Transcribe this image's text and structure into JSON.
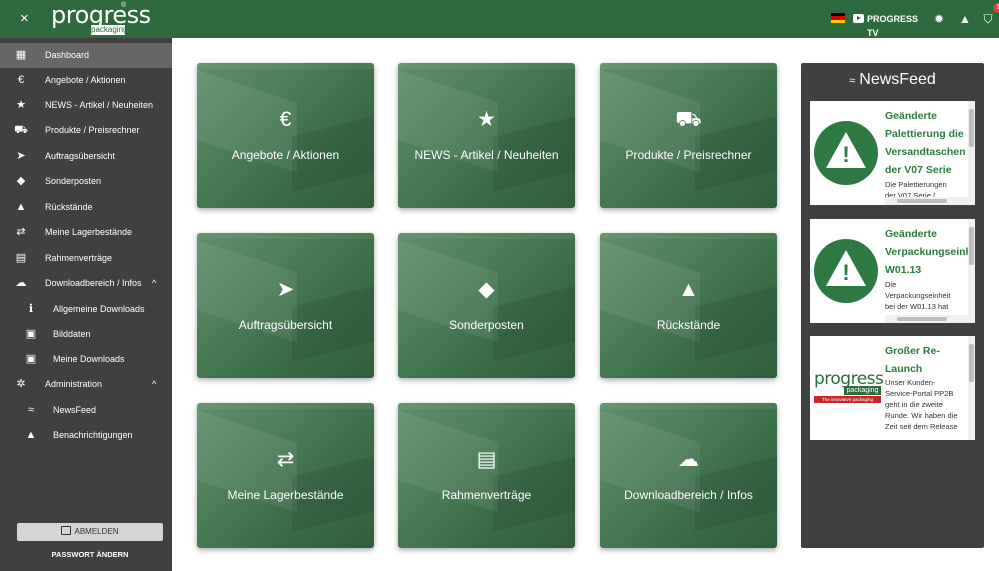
{
  "topbar": {
    "close_glyph": "×",
    "logo_word": "progress",
    "logo_sub": "packaging",
    "logo_reg": "®",
    "tv_label": "PROGRESS TV",
    "cart_count": "1",
    "bg_color": "#2d6a3e",
    "icons": [
      "close-icon",
      "germany-flag-icon",
      "tv-icon",
      "settings-icon",
      "bell-icon",
      "cart-icon"
    ]
  },
  "sidebar": {
    "items": [
      {
        "label": "Dashboard",
        "icon": "dashboard-icon",
        "glyph": "▦"
      },
      {
        "label": "Angebote / Aktionen",
        "icon": "euro-icon",
        "glyph": "€"
      },
      {
        "label": "NEWS - Artikel / Neuheiten",
        "icon": "star-icon",
        "glyph": "★"
      },
      {
        "label": "Produkte / Preisrechner",
        "icon": "truck-icon",
        "glyph": "⛟"
      },
      {
        "label": "Auftragsübersicht",
        "icon": "send-icon",
        "glyph": "➤"
      },
      {
        "label": "Sonderposten",
        "icon": "tag-icon",
        "glyph": "◆"
      },
      {
        "label": "Rückstände",
        "icon": "warning-icon",
        "glyph": "▲"
      },
      {
        "label": "Meine Lagerbestände",
        "icon": "swap-icon",
        "glyph": "⇄"
      },
      {
        "label": "Rahmenverträge",
        "icon": "document-icon",
        "glyph": "▤"
      },
      {
        "label": "Downloadbereich / Infos",
        "icon": "cloud-download-icon",
        "glyph": "☁",
        "caret": "^"
      },
      {
        "label": "Allgemeine Downloads",
        "icon": "info-icon",
        "glyph": "ℹ"
      },
      {
        "label": "Bilddaten",
        "icon": "image-icon",
        "glyph": "▣"
      },
      {
        "label": "Meine Downloads",
        "icon": "account-box-icon",
        "glyph": "▣"
      },
      {
        "label": "Administration",
        "icon": "gear-icon",
        "glyph": "✲",
        "caret": "^"
      },
      {
        "label": "NewsFeed",
        "icon": "rss-icon",
        "glyph": "≈"
      },
      {
        "label": "Benachrichtigungen",
        "icon": "bell-icon",
        "glyph": "▲"
      }
    ],
    "logout_label": "ABMELDEN",
    "password_label": "PASSWORT ÄNDERN"
  },
  "tiles": [
    {
      "label": "Angebote / Aktionen",
      "icon": "euro-icon",
      "glyph": "€"
    },
    {
      "label": "NEWS - Artikel / Neuheiten",
      "icon": "star-icon",
      "glyph": "★"
    },
    {
      "label": "Produkte / Preisrechner",
      "icon": "truck-icon",
      "glyph": "⛟"
    },
    {
      "label": "Auftragsübersicht",
      "icon": "send-icon",
      "glyph": "➤"
    },
    {
      "label": "Sonderposten",
      "icon": "tag-icon",
      "glyph": "◆"
    },
    {
      "label": "Rückstände",
      "icon": "warning-icon",
      "glyph": "▲"
    },
    {
      "label": "Meine Lagerbestände",
      "icon": "swap-icon",
      "glyph": "⇄"
    },
    {
      "label": "Rahmenverträge",
      "icon": "document-icon",
      "glyph": "▤"
    },
    {
      "label": "Downloadbereich / Infos",
      "icon": "cloud-download-icon",
      "glyph": "☁"
    }
  ],
  "newsfeed": {
    "title": "NewsFeed",
    "title_icon": "rss-icon",
    "items": [
      {
        "title_lines": [
          "Geänderte",
          "Palettierung die",
          "Versandtaschen",
          "der V07 Serie"
        ],
        "text_lines": [
          "Die Palettierungen",
          "der V07 Serie /"
        ],
        "thumb": "warning-icon"
      },
      {
        "title_lines": [
          "Geänderte",
          "Verpackungseinh",
          "W01.13"
        ],
        "text_lines": [
          "Die",
          "Verpackungseinheit",
          "bei der W01.13 hat"
        ],
        "thumb": "warning-icon"
      },
      {
        "title_lines": [
          "Großer Re-",
          "Launch"
        ],
        "text_lines": [
          "Unser Kunden-",
          "Service-Portal PP2B",
          "geht in die zweite",
          "Runde. Wir haben die",
          "Zeit seit dem Release"
        ],
        "thumb": "progress-logo",
        "logo_word": "progress",
        "logo_sub": "packaging",
        "logo_tagline": "The innovative packaging Company"
      }
    ]
  },
  "colors": {
    "brand_green": "#2d6a3e",
    "sidebar_bg": "#404040",
    "sidebar_active": "#666666",
    "news_title_green": "#2d7a3e",
    "badge_red": "#e53935"
  }
}
